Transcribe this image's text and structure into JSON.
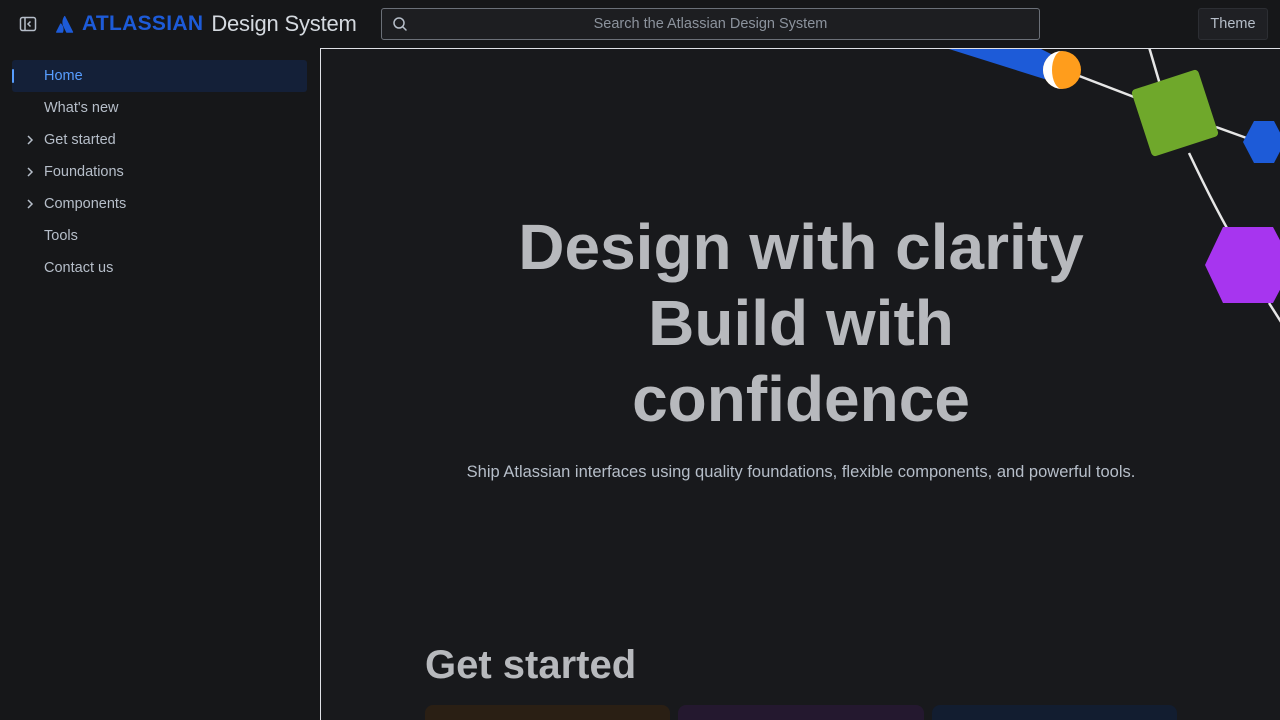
{
  "header": {
    "sidebar_toggle_icon": "sidebar-collapse-icon",
    "logo": {
      "brand": "ATLASSIAN",
      "product": "Design System",
      "brand_color": "#1d5bd8"
    },
    "search": {
      "icon": "search-icon",
      "placeholder": "Search the Atlassian Design System"
    },
    "theme_label": "Theme"
  },
  "sidebar": {
    "items": [
      {
        "label": "Home",
        "active": true,
        "expandable": false
      },
      {
        "label": "What's new",
        "active": false,
        "expandable": false
      },
      {
        "label": "Get started",
        "active": false,
        "expandable": true
      },
      {
        "label": "Foundations",
        "active": false,
        "expandable": true
      },
      {
        "label": "Components",
        "active": false,
        "expandable": true
      },
      {
        "label": "Tools",
        "active": false,
        "expandable": false
      },
      {
        "label": "Contact us",
        "active": false,
        "expandable": false
      }
    ],
    "active_color": "#579dff"
  },
  "main": {
    "hero": {
      "title_lines": [
        "Design with clarity",
        "Build with",
        "confidence"
      ],
      "subtitle": "Ship Atlassian interfaces using quality foundations, flexible components, and powerful tools."
    },
    "section_title": "Get started",
    "decor_colors": {
      "blue": "#1d5bd8",
      "orange": "#ff9d1c",
      "green": "#6fa82b",
      "purple": "#a735ef"
    }
  }
}
